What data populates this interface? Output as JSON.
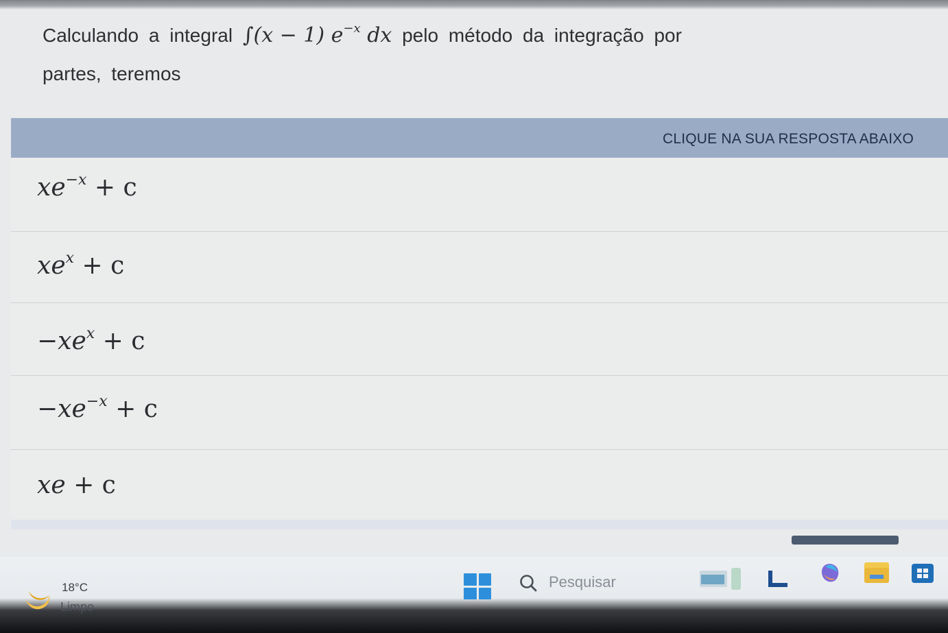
{
  "question": {
    "before": "Calculando a integral",
    "after": "pelo método da integração por",
    "line2": "partes, teremos",
    "integral": {
      "symbol": "∫",
      "factor": "(x − 1)",
      "base": "e",
      "exponent": "−x",
      "differential": "dx"
    }
  },
  "answer_header": "CLIQUE NA SUA RESPOSTA ABAIXO",
  "options": [
    {
      "prefix": "",
      "var": "x",
      "base": "e",
      "exp": "−x",
      "tail": "+ c"
    },
    {
      "prefix": "",
      "var": "x",
      "base": "e",
      "exp": "x",
      "tail": "+ c"
    },
    {
      "prefix": "−",
      "var": "x",
      "base": "e",
      "exp": "x",
      "tail": "+ c"
    },
    {
      "prefix": "−",
      "var": "x",
      "base": "e",
      "exp": "−x",
      "tail": "+ c"
    },
    {
      "prefix": "",
      "var": "x",
      "base": "e",
      "exp": "",
      "tail": "+ c"
    }
  ],
  "taskbar": {
    "weather_temp": "18°C",
    "weather_condition": "Limpo",
    "search_placeholder": "Pesquisar",
    "pinned_icons": [
      "file-explorer-icon",
      "microsoft-365-icon",
      "copilot-icon",
      "folder-icon",
      "store-icon"
    ]
  },
  "colors": {
    "header_bar": "#9aabc6",
    "page_bg": "#e9eaeb",
    "start_blue": "#2d8fdc"
  }
}
